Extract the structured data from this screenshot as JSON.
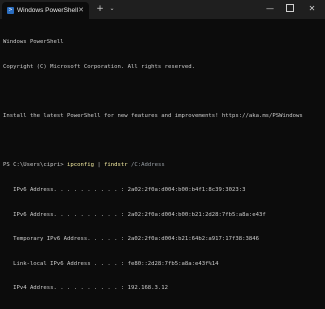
{
  "window": {
    "tab_title": "Windows PowerShell",
    "tab_icon": "powershell-icon",
    "controls": {
      "new_tab": "+",
      "dropdown": "⌄",
      "minimize": "—",
      "close": "✕"
    }
  },
  "console": {
    "header": [
      "Windows PowerShell",
      "Copyright (C) Microsoft Corporation. All rights reserved."
    ],
    "install_notice": "Install the latest PowerShell for new features and improvements! https://aka.ms/PSWindows",
    "prompt": "PS C:\\Users\\cipri> ",
    "command": {
      "cmd1": "ipconfig",
      "pipe": " | ",
      "cmd2": "findstr",
      "arg": " /C:Address"
    },
    "output": [
      "   IPv6 Address. . . . . . . . . . : 2a02:2f0a:d004:b00:b4f1:8c39:3023:3",
      "   IPv6 Address. . . . . . . . . . : 2a02:2f0a:d004:b00:b21:2d28:7fb5:a8a:e43f",
      "   Temporary IPv6 Address. . . . . : 2a02:2f0a:d004:b21:64b2:a917:17f38:3846",
      "   Link-local IPv6 Address . . . . : fe80::2d28:7fb5:a8a:e43f%14",
      "   IPv4 Address. . . . . . . . . . : 192.168.3.12"
    ],
    "colors": {
      "background": "#0c0c0c",
      "text": "#cccccc",
      "command": "#f9f1a5"
    }
  }
}
